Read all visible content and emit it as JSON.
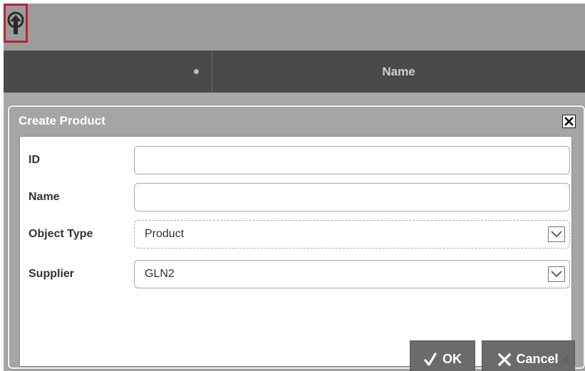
{
  "toolbar": {
    "upload_icon": "upload-arrow-icon"
  },
  "grid": {
    "columns": [
      "",
      "Name"
    ]
  },
  "dialog": {
    "title": "Create Product",
    "fields": [
      {
        "label": "ID",
        "value": ""
      },
      {
        "label": "Name",
        "value": ""
      },
      {
        "label": "Object Type",
        "value": "Product"
      },
      {
        "label": "Supplier",
        "value": "GLN2"
      }
    ],
    "buttons": {
      "ok": "OK",
      "cancel": "Cancel"
    }
  },
  "colors": {
    "toolbar": "#9c9c9c",
    "header": "#4a4a4a",
    "button": "#6b6b6b",
    "highlight": "#b8262e"
  }
}
